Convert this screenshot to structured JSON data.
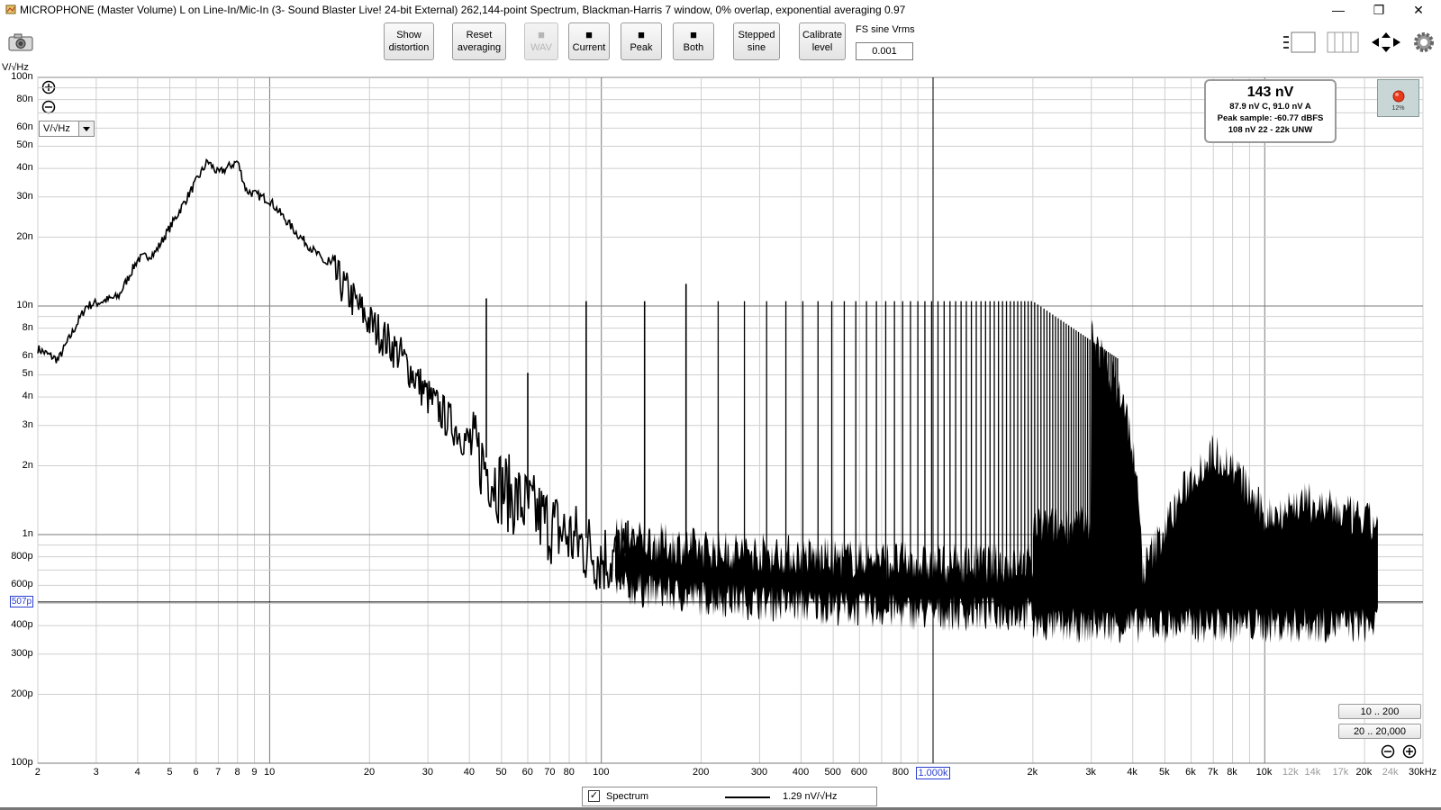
{
  "window": {
    "title": "MICROPHONE (Master Volume) L on Line-In/Mic-In (3- Sound Blaster Live! 24-bit External) 262,144-point Spectrum, Blackman-Harris 7 window, 0% overlap, exponential averaging 0.97",
    "minimize": "—",
    "restore": "❐",
    "close": "✕"
  },
  "toolbar": {
    "show_distortion": [
      "Show",
      "distortion"
    ],
    "reset_averaging": [
      "Reset",
      "averaging"
    ],
    "wav": "WAV",
    "current": "Current",
    "peak": "Peak",
    "both": "Both",
    "stepped_sine": [
      "Stepped",
      "sine"
    ],
    "calibrate_level": [
      "Calibrate",
      "level"
    ],
    "fs_label": "FS sine Vrms",
    "fs_value": "0.001"
  },
  "axis": {
    "y_unit": "V/√Hz",
    "unit_select": "V/√Hz",
    "cursor_y": "507p",
    "cursor_x": "1.000k"
  },
  "readout": {
    "main": "143 nV",
    "line1": "87.9 nV C, 91.0 nV A",
    "line2": "Peak sample: -60.77 dBFS",
    "line3": "108 nV 22 - 22k UNW",
    "status_pct": "12%"
  },
  "range_buttons": {
    "r1": "10 .. 200",
    "r2": "20 .. 20,000"
  },
  "legend": {
    "name": "Spectrum",
    "value": "1.29 nV/√Hz",
    "checked": "✓"
  },
  "colors": {
    "trace": "#000000",
    "grid": "#c8c8c8",
    "grid_major": "#7a7a7a",
    "cursor": "#2a3fd0"
  },
  "chart_data": {
    "type": "line",
    "title": "",
    "xlabel": "",
    "ylabel": "V/√Hz",
    "x_scale": "log",
    "y_scale": "log",
    "xlim": [
      2,
      30000
    ],
    "ylim": [
      1e-10,
      1e-07
    ],
    "grid": true,
    "x_ticks": [
      "2",
      "3",
      "4",
      "5",
      "6",
      "7",
      "8",
      "9",
      "10",
      "20",
      "30",
      "40",
      "50",
      "60",
      "70",
      "80",
      "100",
      "200",
      "300",
      "400",
      "500",
      "600",
      "800",
      "1.000k",
      "2k",
      "3k",
      "4k",
      "5k",
      "6k",
      "7k",
      "8k",
      "10k",
      "12k",
      "14k",
      "17k",
      "20k",
      "24k",
      "30kHz"
    ],
    "y_ticks": [
      "100n",
      "80n",
      "60n",
      "50n",
      "40n",
      "30n",
      "20n",
      "10n",
      "8n",
      "6n",
      "5n",
      "4n",
      "3n",
      "2n",
      "1n",
      "800p",
      "600p",
      "500p",
      "400p",
      "300p",
      "200p",
      "100p"
    ],
    "series": [
      {
        "name": "Spectrum",
        "envelope": [
          [
            2,
            6.5e-09
          ],
          [
            2.3,
            5.8e-09
          ],
          [
            2.8,
            1e-08
          ],
          [
            3.5,
            1.1e-08
          ],
          [
            4,
            1.6e-08
          ],
          [
            4.5,
            1.7e-08
          ],
          [
            5,
            2.2e-08
          ],
          [
            5.5,
            2.8e-08
          ],
          [
            6.5,
            4.3e-08
          ],
          [
            7,
            3.8e-08
          ],
          [
            8,
            4.3e-08
          ],
          [
            8.5,
            3.2e-08
          ],
          [
            10,
            2.9e-08
          ],
          [
            12,
            2.1e-08
          ],
          [
            15,
            1.5e-08
          ],
          [
            20,
            8.5e-09
          ],
          [
            25,
            6e-09
          ],
          [
            30,
            4e-09
          ],
          [
            40,
            2.5e-09
          ],
          [
            50,
            1.6e-09
          ],
          [
            70,
            1.1e-09
          ],
          [
            100,
            8e-10
          ],
          [
            200,
            7e-10
          ],
          [
            400,
            6.5e-10
          ],
          [
            1000,
            6e-10
          ],
          [
            2000,
            6e-10
          ],
          [
            3500,
            5.5e-10
          ],
          [
            4200,
            5e-10
          ],
          [
            6000,
            5e-10
          ],
          [
            10000,
            5e-10
          ],
          [
            20000,
            4.8e-10
          ],
          [
            22000,
            4.5e-10
          ]
        ],
        "spikes": [
          [
            45,
            1.08e-08
          ],
          [
            60,
            5.1e-09
          ],
          [
            90,
            1.05e-08
          ],
          [
            135,
            1.05e-08
          ],
          [
            180,
            1.25e-08
          ]
        ],
        "comb_start": 225,
        "comb_step": 45,
        "comb_end": 3600,
        "comb_level": 1.05e-08,
        "band_top": [
          [
            3000,
            8e-09
          ],
          [
            3300,
            5.5e-09
          ],
          [
            3600,
            4.5e-09
          ],
          [
            3900,
            3e-09
          ],
          [
            4100,
            1.8e-09
          ],
          [
            4300,
            7e-10
          ],
          [
            6000,
            1.8e-09
          ],
          [
            7000,
            2.3e-09
          ],
          [
            8000,
            2e-09
          ],
          [
            10000,
            1.2e-09
          ],
          [
            13000,
            1.4e-09
          ],
          [
            17000,
            1.25e-09
          ],
          [
            22000,
            1.1e-09
          ]
        ],
        "band_bottom": 4e-10
      }
    ]
  }
}
